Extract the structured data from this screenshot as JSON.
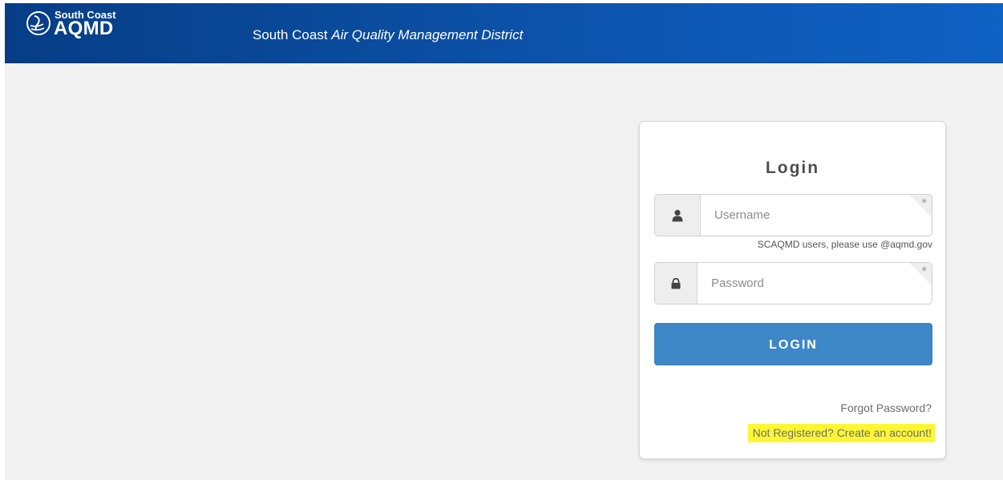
{
  "header": {
    "logo_top": "South Coast",
    "logo_bottom": "AQMD",
    "title_plain": "South Coast ",
    "title_italic": "Air Quality Management District"
  },
  "login": {
    "title": "Login",
    "username_placeholder": "Username",
    "username_hint": "SCAQMD users, please use @aqmd.gov",
    "password_placeholder": "Password",
    "required_marker": "*",
    "button_label": "LOGIN",
    "forgot_link": "Forgot Password?",
    "register_link": "Not Registered? Create an account!"
  },
  "icons": {
    "logo": "aqmd-logo-icon",
    "username": "user-icon",
    "password": "lock-icon"
  },
  "colors": {
    "header_bg": "#0a4b9c",
    "button_bg": "#3e87c6",
    "highlight": "#fdf733",
    "page_bg": "#f2f2f2"
  }
}
